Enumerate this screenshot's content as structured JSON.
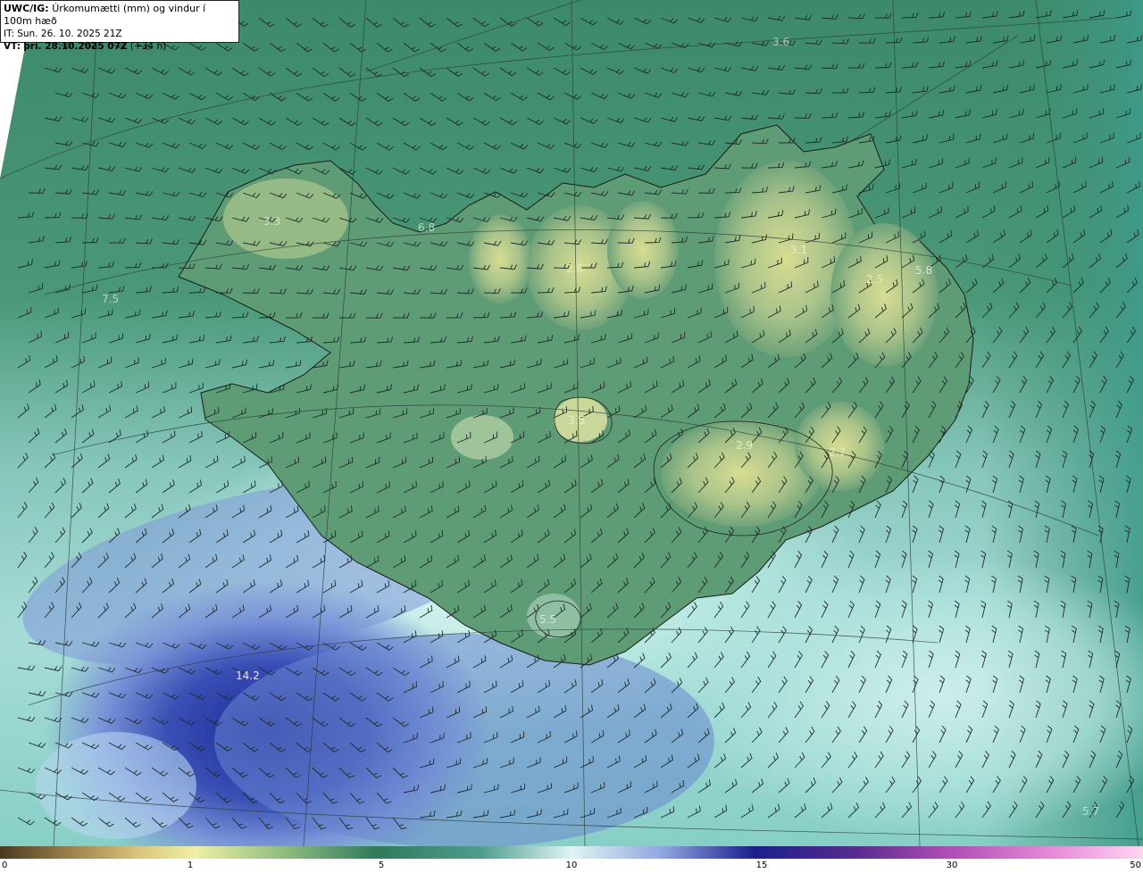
{
  "header": {
    "product": "UWC/IG:",
    "title": "Úrkomumætti (mm) og vindur í 100m hæð",
    "it_line": "IT: Sun. 26. 10. 2025 21Z",
    "vt_prefix": "VT:",
    "vt_bold": "þri. 28.10.2025 07Z",
    "vt_suffix": "(+34 h)"
  },
  "value_labels": [
    {
      "text": "3.6",
      "color": "#a8c8b0"
    },
    {
      "text": "3.3",
      "color": "#cfe3c4"
    },
    {
      "text": "6.8",
      "color": "#b6d2bf"
    },
    {
      "text": "7.5",
      "color": "#b6d2bf"
    },
    {
      "text": "2.8",
      "color": "#e8edc0"
    },
    {
      "text": "3.1",
      "color": "#e8edc0"
    },
    {
      "text": "2.5",
      "color": "#e8edc0"
    },
    {
      "text": "5.8",
      "color": "#d6e6dc"
    },
    {
      "text": "3.5",
      "color": "#eef0c8"
    },
    {
      "text": "2.9",
      "color": "#e8edc0"
    },
    {
      "text": "2.7",
      "color": "#e8edc0"
    },
    {
      "text": "5.5",
      "color": "#cfe6dc"
    },
    {
      "text": "14.2",
      "color": "#dfe5ff"
    },
    {
      "text": "9.3",
      "color": "#a9bde8"
    },
    {
      "text": "5.7",
      "color": "#b6dcd6"
    }
  ],
  "colorbar": {
    "ticks": [
      "0",
      "1",
      "5",
      "10",
      "15",
      "30",
      "50"
    ],
    "colors": [
      "#4a3a1f",
      "#9a7f4c",
      "#d9c27a",
      "#eef0a6",
      "#8dbb80",
      "#2f7a5c",
      "#4f9c8c",
      "#a6dcd6",
      "#dff5f5",
      "#8ea6dd",
      "#4d5fb8",
      "#1a1f8c",
      "#5a2c8f",
      "#b04db3",
      "#e58ad6",
      "#ffd4f2"
    ]
  }
}
